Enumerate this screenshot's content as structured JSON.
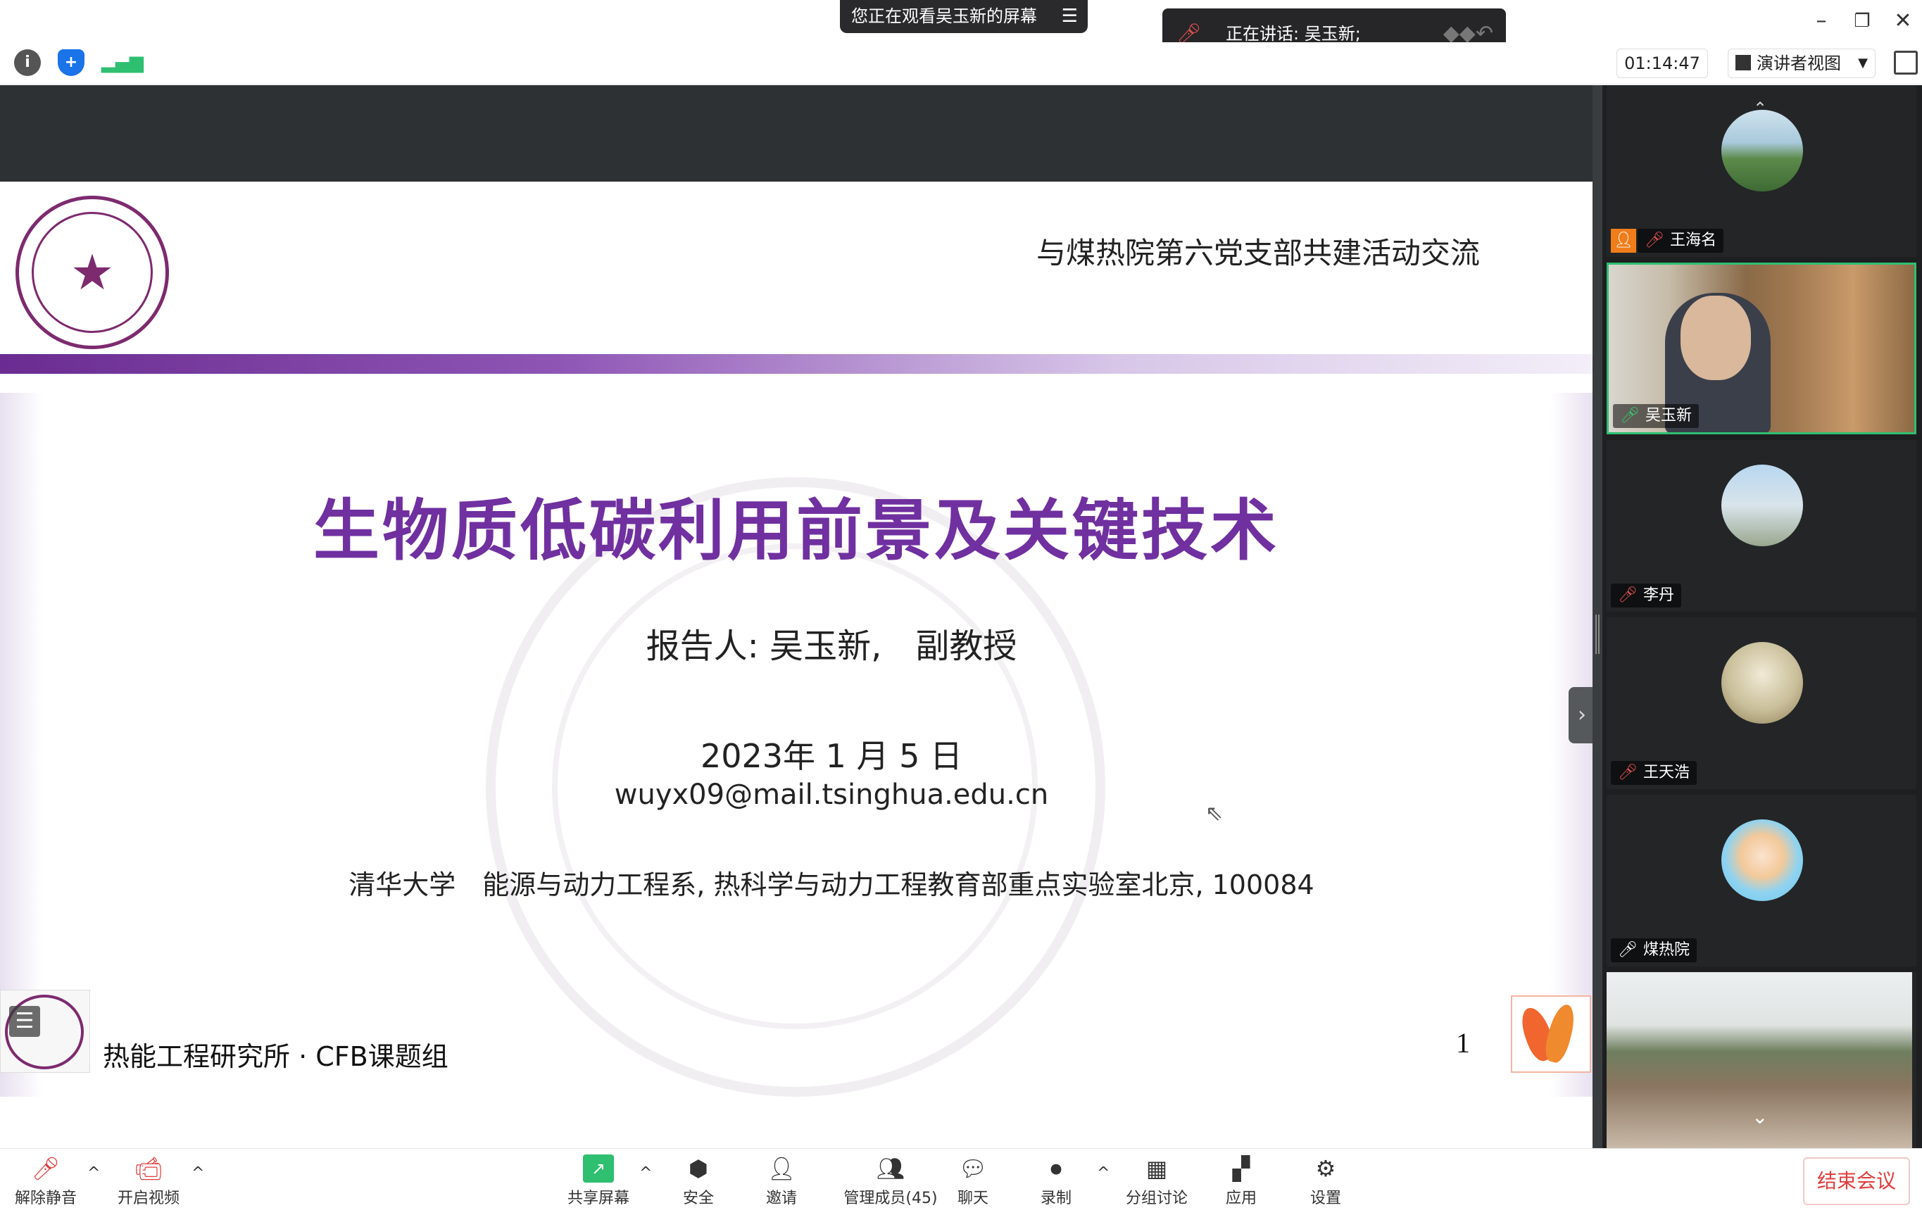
{
  "top_bar": {
    "viewing_banner": "您正在观看吴玉新的屏幕",
    "speaking_banner": "正在讲话: 吴玉新;",
    "window_controls": [
      "minimize-icon",
      "restore-icon",
      "close-icon"
    ]
  },
  "toolbar": {
    "left_icons": [
      "info-icon",
      "shield-icon",
      "signal-icon"
    ],
    "timer": "01:14:47",
    "view_mode": "演讲者视图"
  },
  "slide": {
    "header_title": "与煤热院第六党支部共建活动交流",
    "main_title": "生物质低碳利用前景及关键技术",
    "reporter": "报告人: 吴玉新,　副教授",
    "date": "2023年 1 月 5 日",
    "email": "wuyx09@mail.tsinghua.edu.cn",
    "affiliation": "清华大学　能源与动力工程系, 热科学与动力工程教育部重点实验室北京, 100084",
    "footer": "热能工程研究所 · CFB课题组",
    "page_number": "1"
  },
  "participants": [
    {
      "name": "王海名",
      "mic": "muted",
      "host": true,
      "tile": "avatar"
    },
    {
      "name": "吴玉新",
      "mic": "on",
      "host": false,
      "tile": "video",
      "active": true
    },
    {
      "name": "李丹",
      "mic": "muted",
      "host": false,
      "tile": "avatar"
    },
    {
      "name": "王天浩",
      "mic": "muted",
      "host": false,
      "tile": "avatar"
    },
    {
      "name": "煤热院",
      "mic": "on",
      "host": false,
      "tile": "avatar"
    },
    {
      "name": "",
      "mic": "",
      "host": false,
      "tile": "video"
    }
  ],
  "controls": {
    "unmute": "解除静音",
    "start_video": "开启视频",
    "share_screen": "共享屏幕",
    "security": "安全",
    "invite": "邀请",
    "manage_members": "管理成员(45)",
    "chat": "聊天",
    "record": "录制",
    "breakout": "分组讨论",
    "apps": "应用",
    "settings": "设置",
    "end_meeting": "结束会议"
  },
  "colors": {
    "slide_title": "#7030a0",
    "active_speaker_border": "#2fbf71",
    "end_meeting": "#e03c3c",
    "host_badge": "#f07d1a"
  }
}
